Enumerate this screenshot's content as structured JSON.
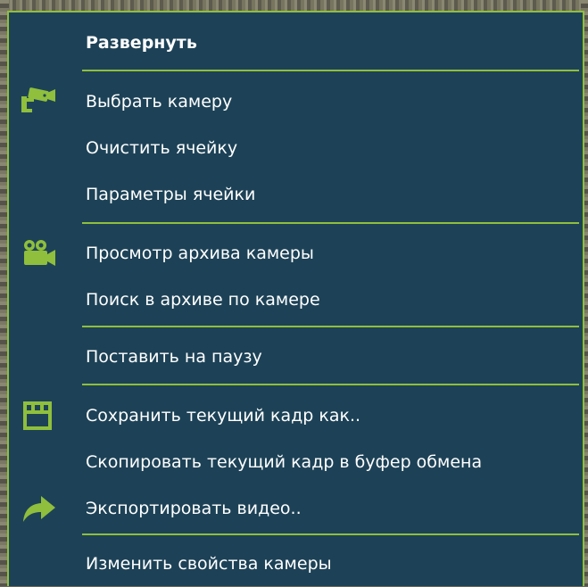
{
  "menu": {
    "accent_color": "#8fbf3c",
    "background_color": "#1d4257",
    "items": [
      {
        "label": "Развернуть",
        "bold": true,
        "icon": null
      },
      {
        "label": "Выбрать камеру",
        "icon": "security-camera-icon"
      },
      {
        "label": "Очистить ячейку",
        "icon": null
      },
      {
        "label": "Параметры ячейки",
        "icon": null
      },
      {
        "label": "Просмотр архива камеры",
        "icon": "video-camera-icon"
      },
      {
        "label": "Поиск в архиве по камере",
        "icon": null
      },
      {
        "label": "Поставить на паузу",
        "icon": null
      },
      {
        "label": "Сохранить текущий кадр как..",
        "icon": "save-floppy-icon"
      },
      {
        "label": "Скопировать текущий кадр в буфер обмена",
        "icon": null
      },
      {
        "label": "Экспортировать видео..",
        "icon": "share-arrow-icon"
      },
      {
        "label": "Изменить свойства камеры",
        "icon": null
      }
    ]
  }
}
